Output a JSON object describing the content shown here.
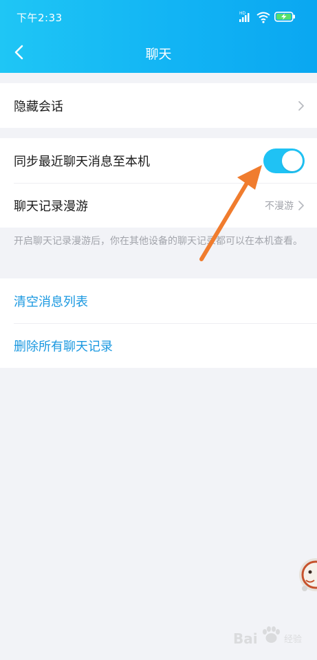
{
  "status_bar": {
    "time": "下午2:33",
    "network_badge": "HD"
  },
  "nav": {
    "title": "聊天",
    "back_icon": "chevron-left-icon"
  },
  "settings": {
    "hide_conversation": {
      "label": "隐藏会话"
    },
    "sync_recent": {
      "label": "同步最近聊天消息至本机",
      "enabled": true
    },
    "roaming": {
      "label": "聊天记录漫游",
      "value": "不漫游"
    },
    "roaming_hint": "开启聊天记录漫游后，你在其他设备的聊天记录都可以在本机查看。",
    "clear_list": {
      "label": "清空消息列表"
    },
    "delete_all": {
      "label": "删除所有聊天记录"
    }
  },
  "watermark": {
    "text": "Bai",
    "sub": "经验"
  },
  "colors": {
    "header_gradient_start": "#1fc6f5",
    "header_gradient_end": "#0aa7f1",
    "toggle_on": "#1fc2f4",
    "link_blue": "#1a98e0",
    "annotation_arrow": "#f07c2e",
    "page_background": "#f2f3f7"
  }
}
